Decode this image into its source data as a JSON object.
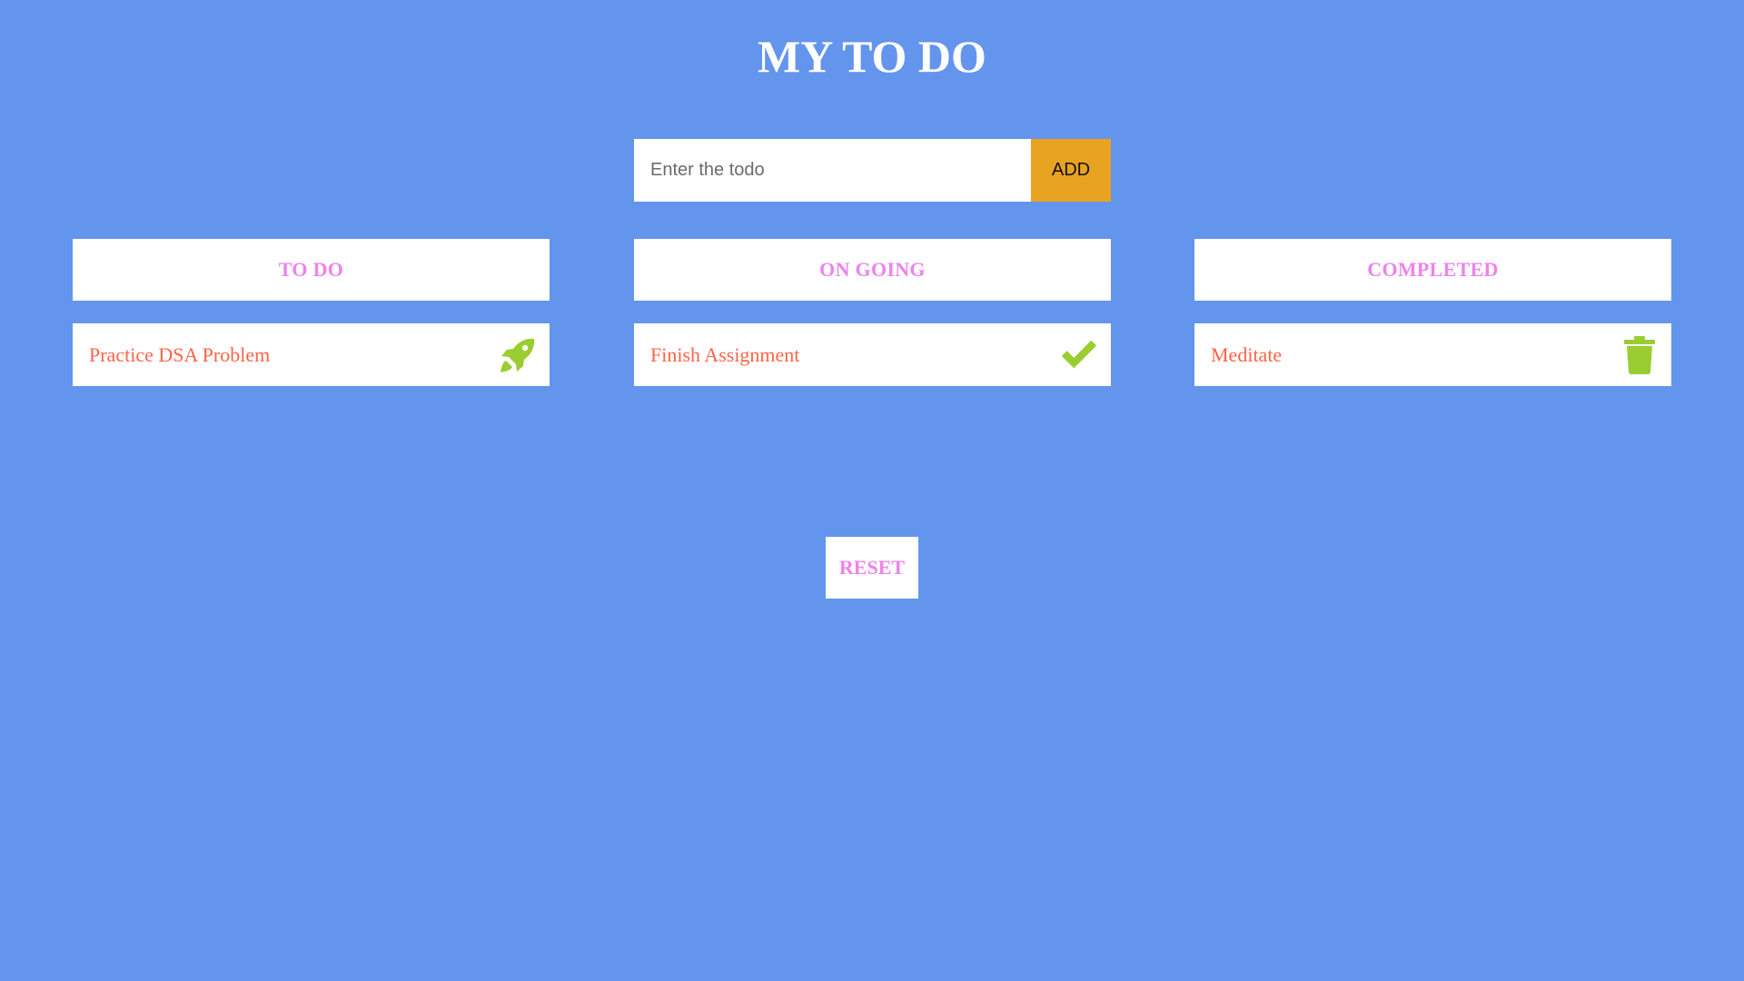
{
  "app": {
    "title": "MY TO DO"
  },
  "add_form": {
    "placeholder": "Enter the todo",
    "value": "",
    "add_label": "ADD"
  },
  "columns": [
    {
      "header": "TO DO",
      "items": [
        {
          "text": "Practice DSA Problem",
          "icon": "rocket-icon"
        }
      ]
    },
    {
      "header": "ON GOING",
      "items": [
        {
          "text": "Finish Assignment",
          "icon": "check-icon"
        }
      ]
    },
    {
      "header": "COMPLETED",
      "items": [
        {
          "text": "Meditate",
          "icon": "trash-icon"
        }
      ]
    }
  ],
  "reset_label": "RESET",
  "colors": {
    "background": "#6495ED",
    "header_text": "#EE82EE",
    "item_text": "#FF6347",
    "icon": "#9ACD32",
    "add_button": "#E8A321",
    "panel": "#FFFFFF"
  }
}
